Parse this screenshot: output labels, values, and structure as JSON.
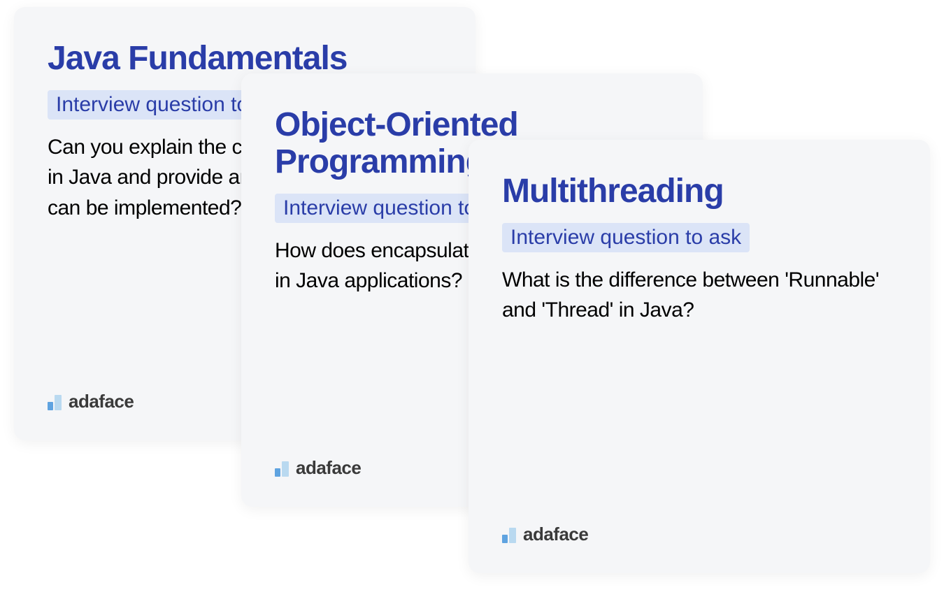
{
  "cards": [
    {
      "title": "Java Fundamentals",
      "badge": "Interview question to ask",
      "question": "Can you explain the concept of 'inheritance' in Java and provide an example of how it can be implemented?"
    },
    {
      "title": "Object-Oriented Programming",
      "badge": "Interview question to ask",
      "question": "How does encapsulation enhance security in Java applications?"
    },
    {
      "title": "Multithreading",
      "badge": "Interview question to ask",
      "question": "What is the difference between 'Runnable' and 'Thread' in Java?"
    }
  ],
  "brand": "adaface"
}
